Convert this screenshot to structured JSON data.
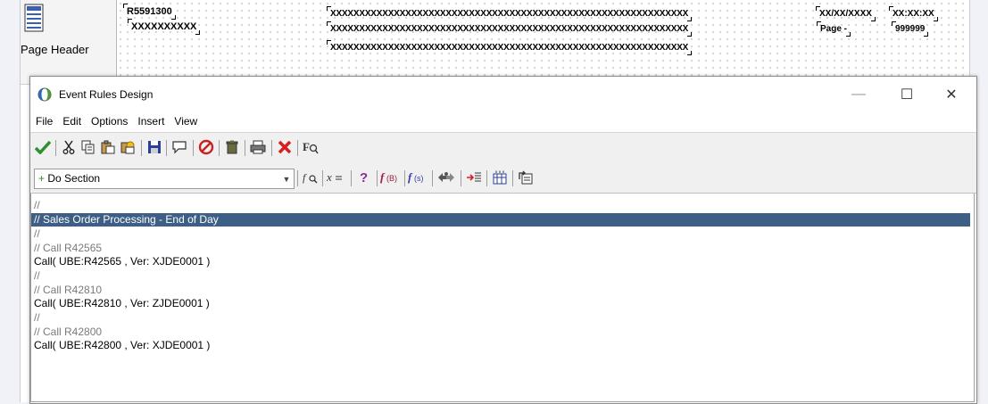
{
  "report": {
    "section_label": "Page Header",
    "fields": {
      "report_id": "R5591300",
      "subtitle": "XXXXXXXXXX",
      "title_line1": "XXXXXXXXXXXXXXXXXXXXXXXXXXXXXXXXXXXXXXXXXXXXXXXXXXXXXXXXXXXXXX",
      "title_line2": "XXXXXXXXXXXXXXXXXXXXXXXXXXXXXXXXXXXXXXXXXXXXXXXXXXXXXXXXXXXXXX",
      "title_line3": "XXXXXXXXXXXXXXXXXXXXXXXXXXXXXXXXXXXXXXXXXXXXXXXXXXXXXXXXXXXXXX",
      "date": "XX/XX/XXXX",
      "time": "XX:XX:XX",
      "page_label": "Page -",
      "page_number": "999999"
    }
  },
  "window": {
    "title": "Event Rules Design",
    "minimize": "—",
    "maximize": "☐",
    "close": "✕"
  },
  "menu": [
    "File",
    "Edit",
    "Options",
    "Insert",
    "View"
  ],
  "toolbar2": {
    "combo_prefix": "+",
    "combo_value": "Do Section"
  },
  "icons": {
    "toolbar": [
      "validate-icon",
      "cut-icon",
      "copy-icon",
      "paste-icon",
      "paste-special-icon",
      "save-icon",
      "comment-icon",
      "cancel-icon",
      "delete-icon",
      "print-icon",
      "close-x-icon",
      "search-icon"
    ],
    "toolbar2": [
      "function-search-icon",
      "assignment-icon",
      "if-icon",
      "business-function-icon",
      "system-function-icon",
      "table-io-icon",
      "insert-icon",
      "variables-icon",
      "report-interconnect-icon"
    ]
  },
  "colors": {
    "selection": "#3d5f86",
    "comment_text": "#7a7a7a",
    "validate_green": "#2f8f2f",
    "error_red": "#d42020"
  },
  "lines": [
    {
      "type": "comment",
      "text": "//"
    },
    {
      "type": "comment",
      "text": "// Sales Order Processing - End of Day"
    },
    {
      "type": "comment",
      "text": "//"
    },
    {
      "type": "comment",
      "text": "// Call R42565"
    },
    {
      "type": "call",
      "text": "Call( UBE:R42565 , Ver: XJDE0001 )"
    },
    {
      "type": "comment",
      "text": "//"
    },
    {
      "type": "comment",
      "text": "// Call R42810"
    },
    {
      "type": "call",
      "text": "Call( UBE:R42810 , Ver: ZJDE0001 )"
    },
    {
      "type": "comment",
      "text": "//"
    },
    {
      "type": "comment",
      "text": "// Call R42800"
    },
    {
      "type": "call",
      "text": "Call( UBE:R42800 , Ver: XJDE0001 )"
    }
  ]
}
